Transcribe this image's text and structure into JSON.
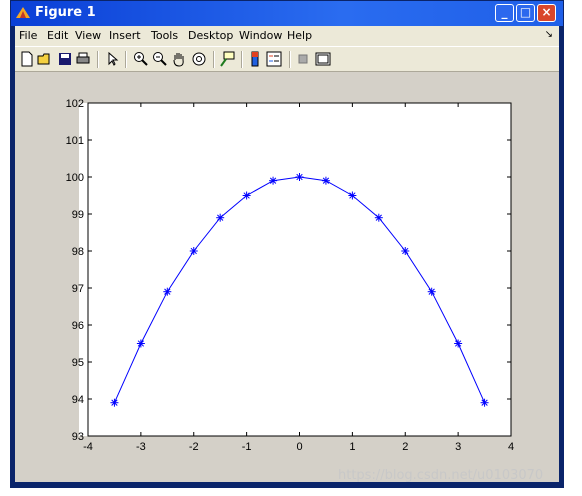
{
  "window": {
    "title": "Figure 1"
  },
  "menu": [
    "File",
    "Edit",
    "View",
    "Insert",
    "Tools",
    "Desktop",
    "Window",
    "Help"
  ],
  "toolbar": [
    "new-figure",
    "open-file",
    "save",
    "print",
    "select-arrow",
    "zoom-in",
    "zoom-out",
    "pan-hand",
    "rotate-3d",
    "data-cursor",
    "colorbar",
    "legend",
    "plot-browser",
    "property-editor"
  ],
  "watermark": "https://blog.csdn.net/u0103070",
  "chart_data": {
    "type": "line",
    "marker": "*",
    "color": "#0000ff",
    "xlim": [
      -4,
      4
    ],
    "ylim": [
      93,
      102
    ],
    "xticks": [
      "-4",
      "-3",
      "-2",
      "-1",
      "0",
      "1",
      "2",
      "3",
      "4"
    ],
    "yticks": [
      "93",
      "94",
      "95",
      "96",
      "97",
      "98",
      "99",
      "100",
      "101",
      "102"
    ],
    "x": [
      -3.5,
      -3,
      -2.5,
      -2,
      -1.5,
      -1,
      -0.5,
      0,
      0.5,
      1,
      1.5,
      2,
      2.5,
      3,
      3.5
    ],
    "y": [
      93.9,
      95.5,
      96.9,
      98.0,
      98.9,
      99.5,
      99.9,
      100.0,
      99.9,
      99.5,
      98.9,
      98.0,
      96.9,
      95.5,
      93.9
    ],
    "grid": false
  }
}
